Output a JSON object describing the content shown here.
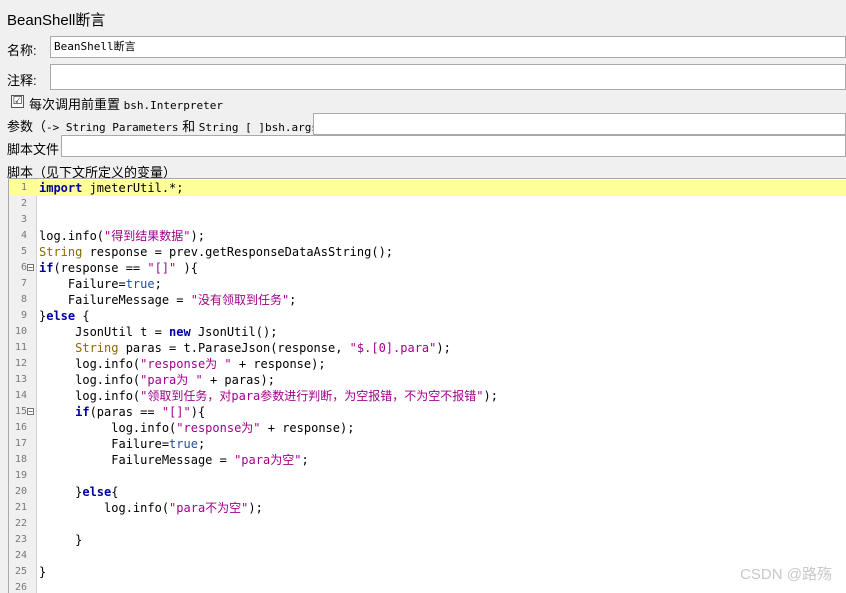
{
  "panel_title": "BeanShell断言",
  "name": {
    "label": "名称:",
    "value": "BeanShell断言"
  },
  "comment": {
    "label": "注释:",
    "value": ""
  },
  "reset": {
    "label": "每次调用前重置",
    "label_mono": "bsh.Interpreter",
    "checked": "☑"
  },
  "params": {
    "label_prefix": "参数（",
    "label_mono": "-> String Parameters",
    "label_mid": "和",
    "label_mono2": "String [ ]bsh.args)",
    "value": ""
  },
  "script_file": {
    "label": "脚本文件",
    "value": ""
  },
  "script_header": "脚本（见下文所定义的变量）",
  "code_lines": [
    [
      {
        "t": "import",
        "c": "kw"
      },
      {
        "t": " jmeterUtil.*;",
        "c": "pl"
      }
    ],
    [],
    [],
    [
      {
        "t": "log.info(",
        "c": "pl"
      },
      {
        "t": "\"得到结果数据\"",
        "c": "st"
      },
      {
        "t": ");",
        "c": "pl"
      }
    ],
    [
      {
        "t": "String",
        "c": "ty"
      },
      {
        "t": " response = prev.getResponseDataAsString();",
        "c": "pl"
      }
    ],
    [
      {
        "t": "if",
        "c": "kw"
      },
      {
        "t": "(response == ",
        "c": "pl"
      },
      {
        "t": "\"[]\"",
        "c": "st"
      },
      {
        "t": " ){",
        "c": "pl"
      }
    ],
    [
      {
        "t": "    Failure=",
        "c": "pl"
      },
      {
        "t": "true",
        "c": "ac"
      },
      {
        "t": ";",
        "c": "pl"
      }
    ],
    [
      {
        "t": "    FailureMessage = ",
        "c": "pl"
      },
      {
        "t": "\"没有领取到任务\"",
        "c": "st"
      },
      {
        "t": ";",
        "c": "pl"
      }
    ],
    [
      {
        "t": "}",
        "c": "pl"
      },
      {
        "t": "else",
        "c": "kw"
      },
      {
        "t": " {",
        "c": "pl"
      }
    ],
    [
      {
        "t": "     JsonUtil t = ",
        "c": "pl"
      },
      {
        "t": "new",
        "c": "kw"
      },
      {
        "t": " JsonUtil();",
        "c": "pl"
      }
    ],
    [
      {
        "t": "     ",
        "c": "pl"
      },
      {
        "t": "String",
        "c": "ty"
      },
      {
        "t": " paras = t.ParaseJson(response, ",
        "c": "pl"
      },
      {
        "t": "\"$.[0].para\"",
        "c": "st"
      },
      {
        "t": ");",
        "c": "pl"
      }
    ],
    [
      {
        "t": "     log.info(",
        "c": "pl"
      },
      {
        "t": "\"response为 \"",
        "c": "st"
      },
      {
        "t": " + response);",
        "c": "pl"
      }
    ],
    [
      {
        "t": "     log.info(",
        "c": "pl"
      },
      {
        "t": "\"para为 \"",
        "c": "st"
      },
      {
        "t": " + paras);",
        "c": "pl"
      }
    ],
    [
      {
        "t": "     log.info(",
        "c": "pl"
      },
      {
        "t": "\"领取到任务，对para参数进行判断，为空报错，不为空不报错\"",
        "c": "st"
      },
      {
        "t": ");",
        "c": "pl"
      }
    ],
    [
      {
        "t": "     ",
        "c": "pl"
      },
      {
        "t": "if",
        "c": "kw"
      },
      {
        "t": "(paras == ",
        "c": "pl"
      },
      {
        "t": "\"[]\"",
        "c": "st"
      },
      {
        "t": "){",
        "c": "pl"
      }
    ],
    [
      {
        "t": "          log.info(",
        "c": "pl"
      },
      {
        "t": "\"response为\"",
        "c": "st"
      },
      {
        "t": " + response);",
        "c": "pl"
      }
    ],
    [
      {
        "t": "          Failure=",
        "c": "pl"
      },
      {
        "t": "true",
        "c": "ac"
      },
      {
        "t": ";",
        "c": "pl"
      }
    ],
    [
      {
        "t": "          FailureMessage = ",
        "c": "pl"
      },
      {
        "t": "\"para为空\"",
        "c": "st"
      },
      {
        "t": ";",
        "c": "pl"
      }
    ],
    [],
    [
      {
        "t": "     }",
        "c": "pl"
      },
      {
        "t": "else",
        "c": "kw"
      },
      {
        "t": "{",
        "c": "pl"
      }
    ],
    [
      {
        "t": "         log.info(",
        "c": "pl"
      },
      {
        "t": "\"para不为空\"",
        "c": "st"
      },
      {
        "t": ");",
        "c": "pl"
      }
    ],
    [],
    [
      {
        "t": "     }",
        "c": "pl"
      }
    ],
    [],
    [
      {
        "t": "}",
        "c": "pl"
      }
    ],
    []
  ],
  "line_numbers": [
    "1",
    "2",
    "3",
    "4",
    "5",
    "6",
    "7",
    "8",
    "9",
    "10",
    "11",
    "12",
    "13",
    "14",
    "15",
    "16",
    "17",
    "18",
    "19",
    "20",
    "21",
    "22",
    "23",
    "24",
    "25",
    "26"
  ],
  "fold_lines": [
    "6",
    "15"
  ],
  "highlight_line": "1",
  "watermark": "CSDN @路殇"
}
